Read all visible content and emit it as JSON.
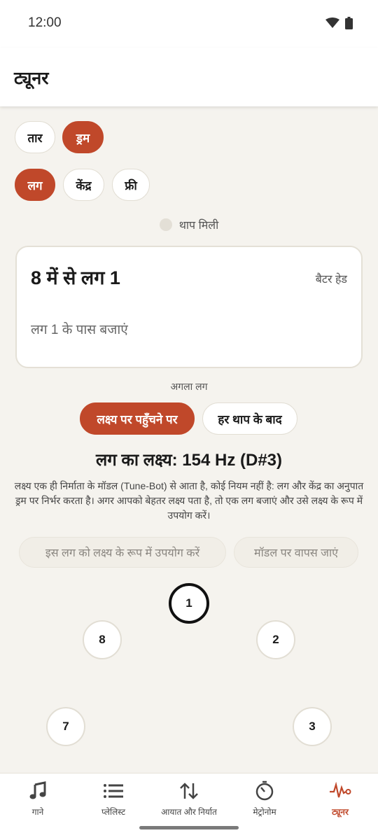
{
  "status_bar": {
    "time": "12:00"
  },
  "app_bar": {
    "title": "ट्यूनर"
  },
  "instrument_chips": [
    {
      "label": "तार",
      "active": false
    },
    {
      "label": "ड्रम",
      "active": true
    }
  ],
  "mode_chips": [
    {
      "label": "लग",
      "active": true
    },
    {
      "label": "केंद्र",
      "active": false
    },
    {
      "label": "फ्री",
      "active": false
    }
  ],
  "beat_indicator": {
    "label": "थाप मिली"
  },
  "lug_card": {
    "title": "8 में से लग 1",
    "head": "बैटर हेड",
    "hint": "लग 1 के पास बजाएं"
  },
  "next_lug": {
    "label": "अगला लग",
    "options": [
      {
        "label": "लक्ष्य पर पहुँचने पर",
        "active": true
      },
      {
        "label": "हर थाप के बाद",
        "active": false
      }
    ]
  },
  "target": {
    "text": "लग का लक्ष्य: 154 Hz (D#3)",
    "explanation": "लक्ष्य एक ही निर्माता के मॉडल (Tune-Bot) से आता है, कोई नियम नहीं है: लग और केंद्र का अनुपात ड्रम पर निर्भर करता है। अगर आपको बेहतर लक्ष्य पता है, तो एक लग बजाएं और उसे लक्ष्य के रूप में उपयोग करें।"
  },
  "actions": {
    "use_as_target": "इस लग को लक्ष्य के रूप में उपयोग करें",
    "back_to_model": "मॉडल पर वापस जाएं"
  },
  "lugs": [
    {
      "label": "1",
      "current": true
    },
    {
      "label": "2",
      "current": false
    },
    {
      "label": "3",
      "current": false
    },
    {
      "label": "7",
      "current": false
    },
    {
      "label": "8",
      "current": false
    }
  ],
  "bottom_nav": [
    {
      "label": "गाने",
      "icon": "music-note-icon",
      "active": false
    },
    {
      "label": "प्लेलिस्ट",
      "icon": "list-icon",
      "active": false
    },
    {
      "label": "आयात और निर्यात",
      "icon": "import-export-icon",
      "active": false
    },
    {
      "label": "मेट्रोनोम",
      "icon": "metronome-icon",
      "active": false
    },
    {
      "label": "ट्यूनर",
      "icon": "waveform-icon",
      "active": true
    }
  ],
  "colors": {
    "accent": "#c0482a",
    "background": "#f5f3ee",
    "surface": "#ffffff"
  }
}
